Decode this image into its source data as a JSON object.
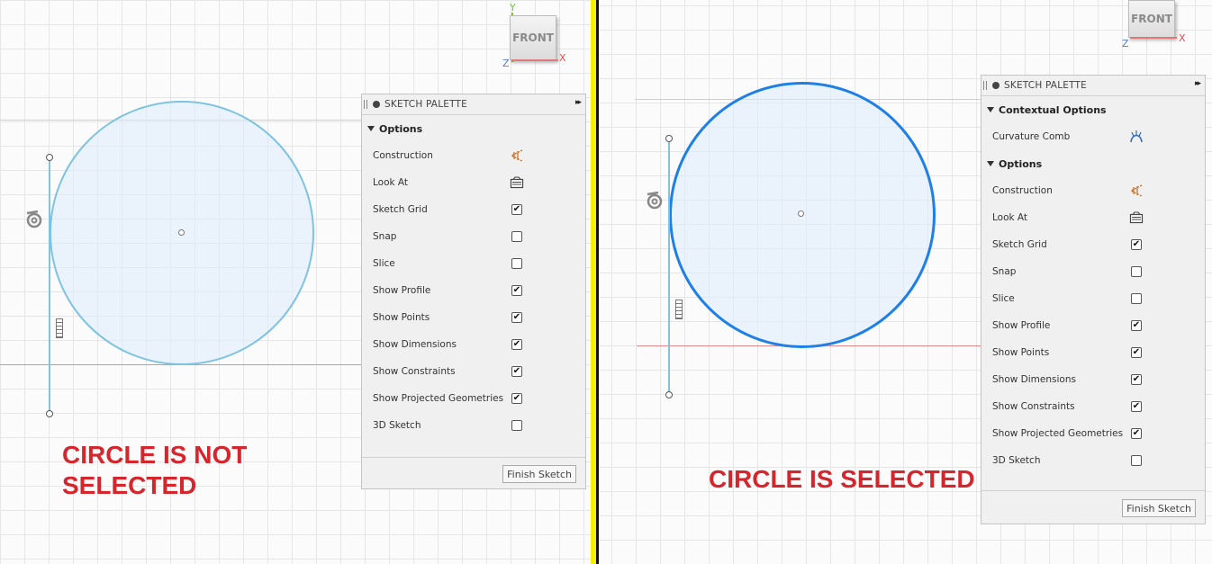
{
  "left": {
    "viewcube": {
      "face": "FRONT",
      "axis_y": "Y",
      "axis_x": "X",
      "axis_z": "Z"
    },
    "palette": {
      "title": "SKETCH PALETTE",
      "expand_glyph": "▸▸",
      "options_header": "Options",
      "rows": [
        {
          "label": "Construction",
          "control": "construction-icon",
          "checked": null
        },
        {
          "label": "Look At",
          "control": "look-at-icon",
          "checked": null
        },
        {
          "label": "Sketch Grid",
          "control": "checkbox",
          "checked": true
        },
        {
          "label": "Snap",
          "control": "checkbox",
          "checked": false
        },
        {
          "label": "Slice",
          "control": "checkbox",
          "checked": false
        },
        {
          "label": "Show Profile",
          "control": "checkbox",
          "checked": true
        },
        {
          "label": "Show Points",
          "control": "checkbox",
          "checked": true
        },
        {
          "label": "Show Dimensions",
          "control": "checkbox",
          "checked": true
        },
        {
          "label": "Show Constraints",
          "control": "checkbox",
          "checked": true
        },
        {
          "label": "Show Projected Geometries",
          "control": "checkbox",
          "checked": true
        },
        {
          "label": "3D Sketch",
          "control": "checkbox",
          "checked": false
        }
      ],
      "finish_button": "Finish Sketch"
    },
    "note_line1": "CIRCLE IS NOT",
    "note_line2": "SELECTED",
    "circle_stroke": "#7ec3df"
  },
  "right": {
    "viewcube": {
      "face": "FRONT",
      "axis_x": "X",
      "axis_z": "Z"
    },
    "palette": {
      "title": "SKETCH PALETTE",
      "expand_glyph": "▸▸",
      "contextual_header": "Contextual Options",
      "contextual_row": {
        "label": "Curvature Comb",
        "control": "curvature-comb-icon"
      },
      "options_header": "Options",
      "rows": [
        {
          "label": "Construction",
          "control": "construction-icon",
          "checked": null
        },
        {
          "label": "Look At",
          "control": "look-at-icon",
          "checked": null
        },
        {
          "label": "Sketch Grid",
          "control": "checkbox",
          "checked": true
        },
        {
          "label": "Snap",
          "control": "checkbox",
          "checked": false
        },
        {
          "label": "Slice",
          "control": "checkbox",
          "checked": false
        },
        {
          "label": "Show Profile",
          "control": "checkbox",
          "checked": true
        },
        {
          "label": "Show Points",
          "control": "checkbox",
          "checked": true
        },
        {
          "label": "Show Dimensions",
          "control": "checkbox",
          "checked": true
        },
        {
          "label": "Show Constraints",
          "control": "checkbox",
          "checked": true
        },
        {
          "label": "Show Projected Geometries",
          "control": "checkbox",
          "checked": true
        },
        {
          "label": "3D Sketch",
          "control": "checkbox",
          "checked": false
        }
      ],
      "finish_button": "Finish Sketch"
    },
    "note": "CIRCLE IS SELECTED",
    "circle_stroke": "#1e7fe6"
  },
  "colors": {
    "divider": "#f5f000",
    "note": "#d6262d",
    "axis_red": "#e88a8a"
  }
}
